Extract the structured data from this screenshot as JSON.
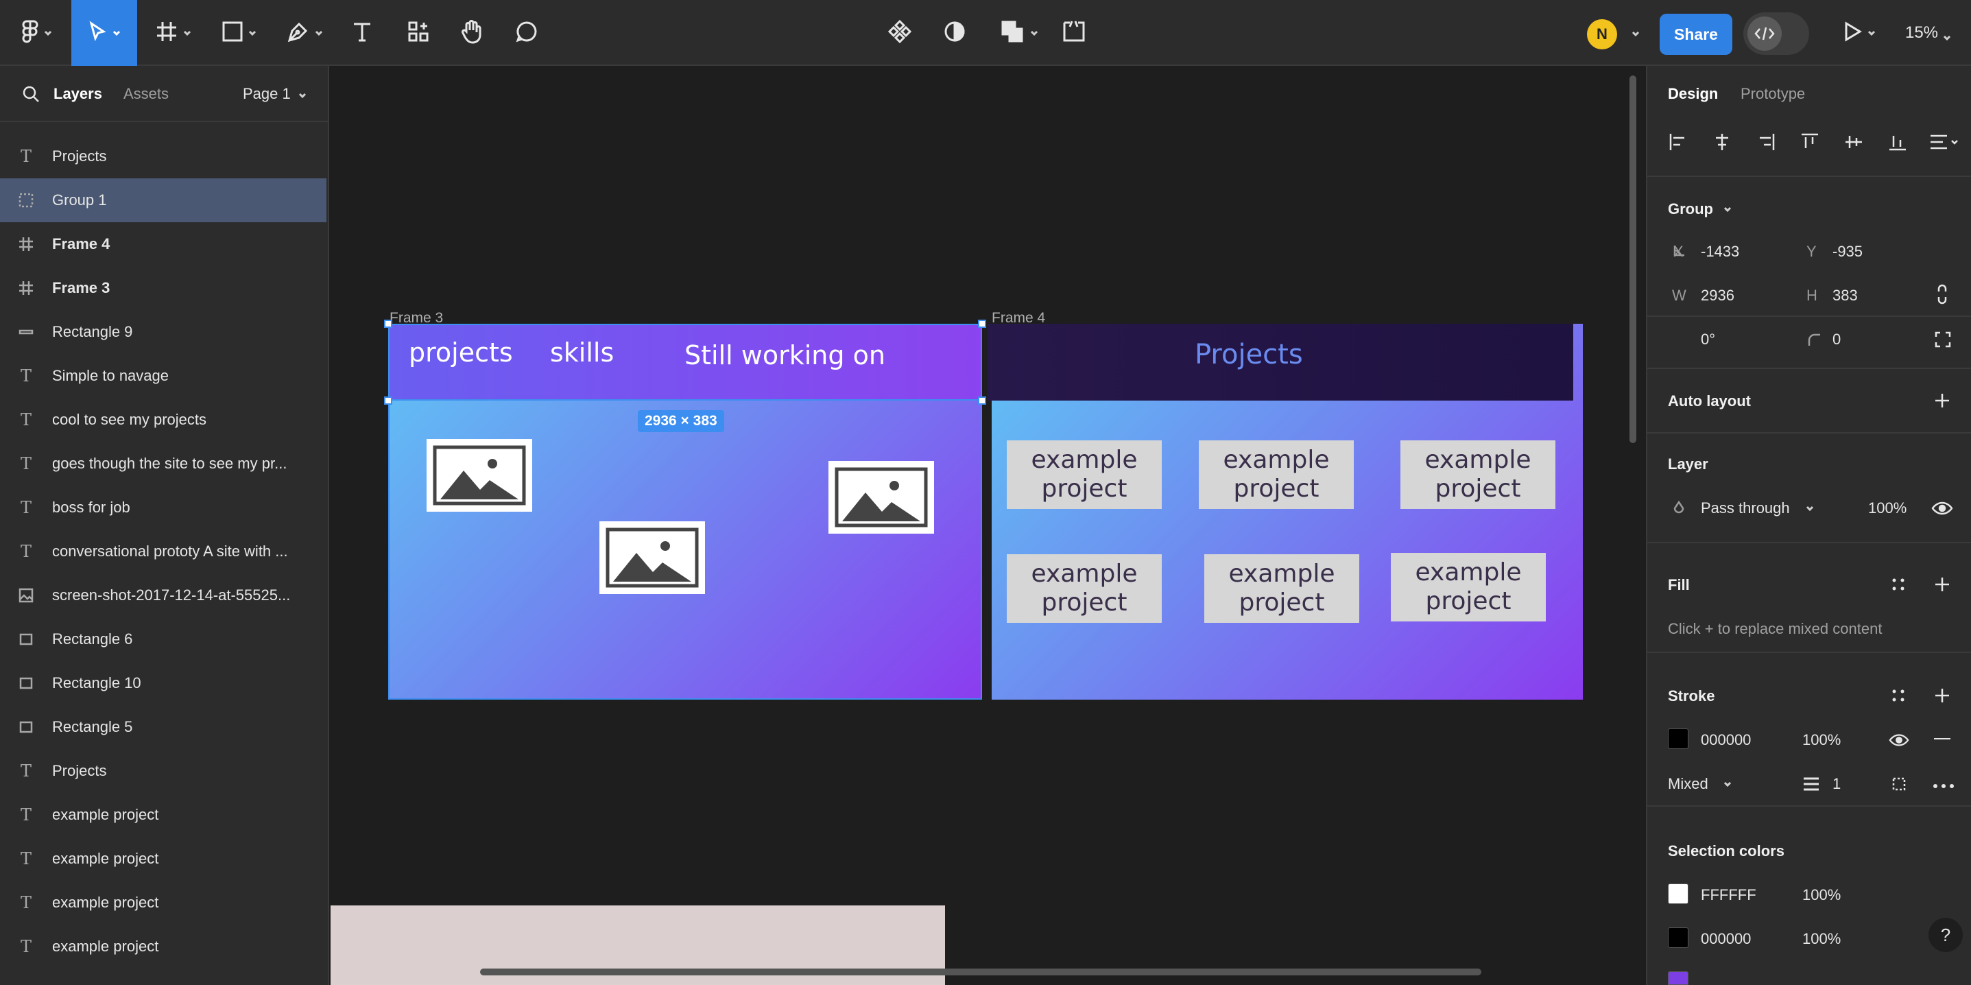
{
  "toolbar": {
    "share_label": "Share",
    "avatar_initial": "N",
    "zoom_label": "15%"
  },
  "left_panel": {
    "tabs": {
      "layers": "Layers",
      "assets": "Assets"
    },
    "page_selector": "Page 1",
    "layers": [
      {
        "name": "Projects",
        "type": "text",
        "selected": false,
        "bold": false
      },
      {
        "name": "Group 1",
        "type": "group",
        "selected": true,
        "bold": false
      },
      {
        "name": "Frame 4",
        "type": "frame",
        "selected": false,
        "bold": true
      },
      {
        "name": "Frame 3",
        "type": "frame",
        "selected": false,
        "bold": true
      },
      {
        "name": "Rectangle 9",
        "type": "line",
        "selected": false,
        "bold": false
      },
      {
        "name": "Simple to navage",
        "type": "text",
        "selected": false,
        "bold": false
      },
      {
        "name": "cool to see my projects",
        "type": "text",
        "selected": false,
        "bold": false
      },
      {
        "name": "goes though the site to see my pr...",
        "type": "text",
        "selected": false,
        "bold": false
      },
      {
        "name": "boss for job",
        "type": "text",
        "selected": false,
        "bold": false
      },
      {
        "name": "conversational prototy A site with ...",
        "type": "text",
        "selected": false,
        "bold": false
      },
      {
        "name": "screen-shot-2017-12-14-at-55525...",
        "type": "image",
        "selected": false,
        "bold": false
      },
      {
        "name": "Rectangle 6",
        "type": "rect",
        "selected": false,
        "bold": false
      },
      {
        "name": "Rectangle 10",
        "type": "rect",
        "selected": false,
        "bold": false
      },
      {
        "name": "Rectangle 5",
        "type": "rect",
        "selected": false,
        "bold": false
      },
      {
        "name": "Projects",
        "type": "text",
        "selected": false,
        "bold": false
      },
      {
        "name": "example project",
        "type": "text",
        "selected": false,
        "bold": false
      },
      {
        "name": "example project",
        "type": "text",
        "selected": false,
        "bold": false
      },
      {
        "name": "example project",
        "type": "text",
        "selected": false,
        "bold": false
      },
      {
        "name": "example project",
        "type": "text",
        "selected": false,
        "bold": false
      }
    ]
  },
  "canvas": {
    "frame_left_label": "Frame 3",
    "frame_right_label": "Frame 4",
    "selection_size": "2936 × 383",
    "left_frame_nav": {
      "projects": "projects",
      "skills": "skills",
      "working": "Still working on"
    },
    "right_frame_title": "Projects",
    "example_projects": [
      "example\nproject",
      "example\nproject",
      "example\nproject",
      "example\nproject",
      "example\nproject",
      "example\nproject"
    ]
  },
  "right_panel": {
    "tabs": {
      "design": "Design",
      "prototype": "Prototype"
    },
    "group_title": "Group",
    "x_label": "X",
    "x_value": "-1433",
    "y_label": "Y",
    "y_value": "-935",
    "w_label": "W",
    "w_value": "2936",
    "h_label": "H",
    "h_value": "383",
    "rotation_value": "0°",
    "radius_value": "0",
    "auto_layout_title": "Auto layout",
    "layer_title": "Layer",
    "blend_mode": "Pass through",
    "layer_opacity": "100%",
    "fill_title": "Fill",
    "fill_hint": "Click + to replace mixed content",
    "stroke_title": "Stroke",
    "stroke_color": "000000",
    "stroke_opacity": "100%",
    "stroke_style": "Mixed",
    "stroke_weight": "1",
    "selection_colors_title": "Selection colors",
    "selection_colors": [
      {
        "hex": "FFFFFF",
        "opacity": "100%",
        "color": "#FFFFFF"
      },
      {
        "hex": "000000",
        "opacity": "100%",
        "color": "#000000"
      }
    ],
    "help_label": "?"
  }
}
